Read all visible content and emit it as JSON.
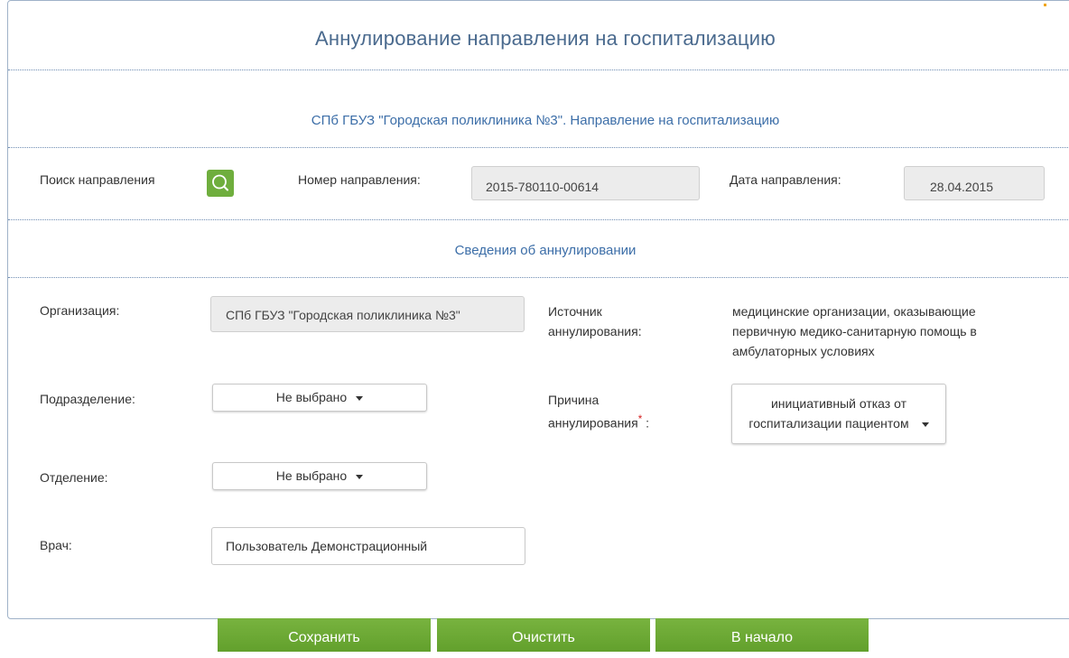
{
  "header": {
    "title": "Аннулирование направления на госпитализацию"
  },
  "org_section": {
    "title": "СПб ГБУЗ \"Городская поликлиника №3\". Направление на госпитализацию"
  },
  "search": {
    "label": "Поиск направления",
    "icon": "search-icon",
    "number_label": "Номер направления:",
    "number_value": "2015-780110-00614",
    "date_label": "Дата направления:",
    "date_value": "28.04.2015"
  },
  "cancel_section": {
    "title": "Сведения об аннулировании"
  },
  "form": {
    "organization_label": "Организация:",
    "organization_value": "СПб ГБУЗ \"Городская поликлиника №3\"",
    "source_label_1": "Источник",
    "source_label_2": "аннулирования:",
    "source_value_1": "медицинские организации, оказывающие",
    "source_value_2": "первичную медико-санитарную помощь в",
    "source_value_3": "амбулаторных условиях",
    "division_label": "Подразделение:",
    "division_value": "Не выбрано",
    "reason_label_1": "Причина",
    "reason_label_2": "аннулирования",
    "reason_required": "*",
    "reason_colon": " :",
    "reason_value_1": "инициативный отказ от",
    "reason_value_2": "госпитализации пациентом",
    "department_label": "Отделение:",
    "department_value": "Не выбрано",
    "doctor_label": "Врач:",
    "doctor_value": "Пользователь Демонстрационный"
  },
  "buttons": {
    "save": "Сохранить",
    "clear": "Очистить",
    "home": "В начало"
  },
  "colors": {
    "accent_green": "#6fae3d",
    "title_blue": "#4a6a8e",
    "section_blue": "#3c6ea8",
    "required_red": "#d42020"
  }
}
